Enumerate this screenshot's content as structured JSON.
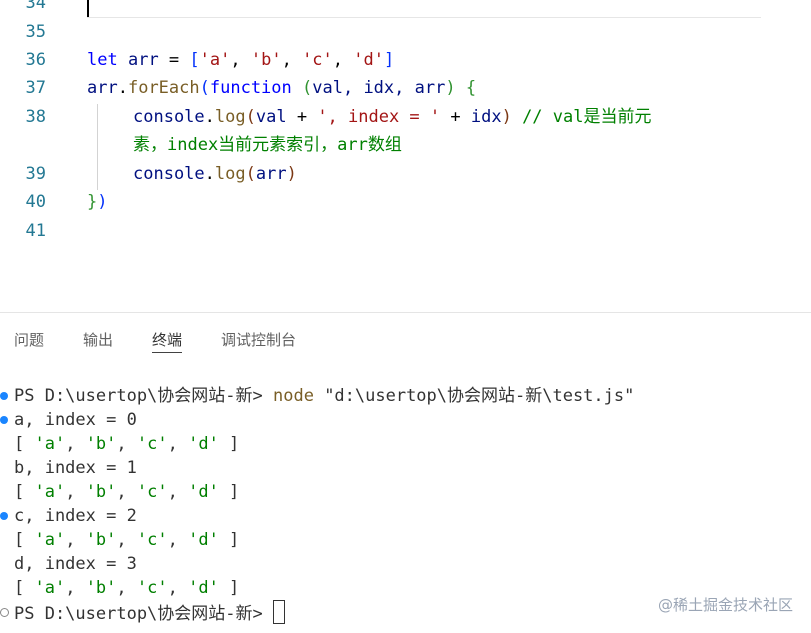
{
  "editor": {
    "line_numbers": [
      "34",
      "35",
      "36",
      "37",
      "38",
      "",
      "39",
      "40",
      "41"
    ],
    "code": {
      "l36": {
        "let": "let",
        "arr": "arr",
        "eq": " = ",
        "open": "[",
        "a": "'a'",
        "c1": ", ",
        "b": "'b'",
        "c2": ", ",
        "c": "'c'",
        "c3": ", ",
        "d": "'d'",
        "close": "]"
      },
      "l37": {
        "arr": "arr",
        "dot": ".",
        "forEach": "forEach",
        "open": "(",
        "function": "function",
        "sp": " ",
        "popen": "(",
        "params": "val, idx, arr",
        "pclose": ")",
        "brace": " {"
      },
      "l38a": {
        "console": "console",
        "dot": ".",
        "log": "log",
        "open": "(",
        "val": "val",
        "plus1": " + ",
        "str": "', index = '",
        "plus2": " + ",
        "idx": "idx",
        "close": ")",
        "comment": " // val是当前元"
      },
      "l38b": {
        "comment": "素，index当前元素索引，arr数组"
      },
      "l39": {
        "console": "console",
        "dot": ".",
        "log": "log",
        "open": "(",
        "arr": "arr",
        "close": ")"
      },
      "l40": {
        "brace": "}",
        "paren": ")"
      }
    }
  },
  "panel": {
    "tabs": [
      "问题",
      "输出",
      "终端",
      "调试控制台"
    ],
    "active_tab": "终端"
  },
  "terminal": {
    "prompt1": "PS D:\\usertop\\协会网站-新> ",
    "cmd": "node",
    "arg": " \"d:\\usertop\\协会网站-新\\test.js\"",
    "lines": [
      "a, index = 0",
      "[ 'a', 'b', 'c', 'd' ]",
      "b, index = 1",
      "[ 'a', 'b', 'c', 'd' ]",
      "c, index = 2",
      "[ 'a', 'b', 'c', 'd' ]",
      "d, index = 3",
      "[ 'a', 'b', 'c', 'd' ]"
    ],
    "prompt2": "PS D:\\usertop\\协会网站-新> "
  },
  "watermark": "@稀土掘金技术社区"
}
